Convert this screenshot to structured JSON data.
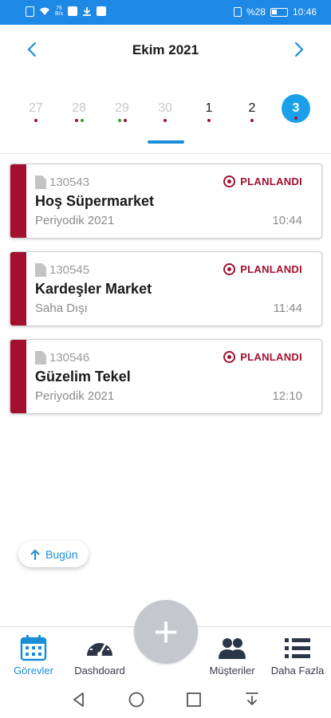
{
  "statusbar": {
    "speed_top": "76",
    "speed_bottom": "B/s",
    "battery_text": "%28",
    "time": "10:46"
  },
  "header": {
    "month_title": "Ekim 2021"
  },
  "week": {
    "days": [
      {
        "num": "27",
        "state": "past",
        "dots": [
          "#a3102f"
        ]
      },
      {
        "num": "28",
        "state": "past",
        "dots": [
          "#a3102f",
          "#3a9a3a"
        ]
      },
      {
        "num": "29",
        "state": "past",
        "dots": [
          "#3a9a3a",
          "#a3102f"
        ]
      },
      {
        "num": "30",
        "state": "past",
        "dots": [
          "#a3102f"
        ]
      },
      {
        "num": "1",
        "state": "current",
        "dots": [
          "#a3102f"
        ]
      },
      {
        "num": "2",
        "state": "current",
        "dots": [
          "#a3102f"
        ]
      },
      {
        "num": "3",
        "state": "selected",
        "dots": [
          "#a3102f"
        ]
      }
    ]
  },
  "tasks": [
    {
      "code": "130543",
      "status": "PLANLANDI",
      "title": "Hoş Süpermarket",
      "subtitle": "Periyodik 2021",
      "time": "10:44"
    },
    {
      "code": "130545",
      "status": "PLANLANDI",
      "title": "Kardeşler Market",
      "subtitle": "Saha Dışı",
      "time": "11:44"
    },
    {
      "code": "130546",
      "status": "PLANLANDI",
      "title": "Güzelim Tekel",
      "subtitle": "Periyodik 2021",
      "time": "12:10"
    }
  ],
  "today_button": {
    "label": "Bugün",
    "icon": "arrow-up-icon"
  },
  "bottomnav": {
    "items": [
      {
        "label": "Görevler",
        "icon": "calendar-icon",
        "active": true
      },
      {
        "label": "Dashdoard",
        "icon": "speedometer-icon",
        "active": false
      },
      {
        "label": "Müşteriler",
        "icon": "users-icon",
        "active": false
      },
      {
        "label": "Daha Fazla",
        "icon": "list-icon",
        "active": false
      }
    ],
    "fab_label": "+"
  },
  "colors": {
    "primary": "#1a8fd8",
    "status_red": "#a3102f",
    "statusbar": "#1e88e5"
  }
}
